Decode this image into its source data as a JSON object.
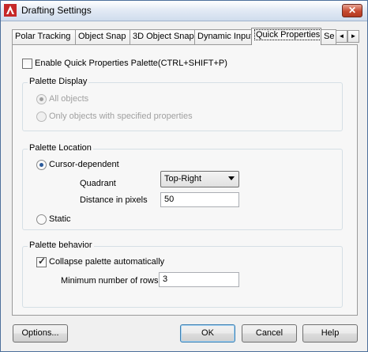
{
  "window": {
    "title": "Drafting Settings",
    "close_label": "✕"
  },
  "tabs": [
    {
      "label": "Polar Tracking"
    },
    {
      "label": "Object Snap"
    },
    {
      "label": "3D Object Snap"
    },
    {
      "label": "Dynamic Input"
    },
    {
      "label": "Quick Properties"
    },
    {
      "label": "Se"
    }
  ],
  "tab_scroll": {
    "left": "◄",
    "right": "►"
  },
  "enable_qp": {
    "label": "Enable Quick Properties Palette(CTRL+SHIFT+P)",
    "checked": false
  },
  "palette_display": {
    "title": "Palette Display",
    "all_objects": "All objects",
    "specified": "Only objects with specified properties"
  },
  "palette_location": {
    "title": "Palette Location",
    "cursor_dependent": "Cursor-dependent",
    "quadrant_label": "Quadrant",
    "quadrant_value": "Top-Right",
    "distance_label": "Distance in pixels",
    "distance_value": "50",
    "static": "Static"
  },
  "palette_behavior": {
    "title": "Palette behavior",
    "collapse_label": "Collapse palette automatically",
    "collapse_checked": true,
    "min_rows_label": "Minimum number of rows",
    "min_rows_value": "3"
  },
  "buttons": {
    "options": "Options...",
    "ok": "OK",
    "cancel": "Cancel",
    "help": "Help"
  }
}
